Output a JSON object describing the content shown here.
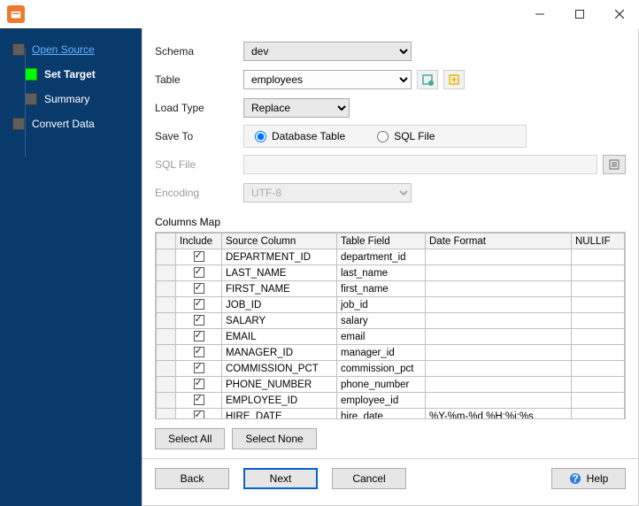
{
  "window": {
    "minimize": "—",
    "maximize": "☐",
    "close": "✕"
  },
  "sidebar": {
    "items": [
      {
        "label": "Open Source"
      },
      {
        "label": "Set Target"
      },
      {
        "label": "Summary"
      },
      {
        "label": "Convert Data"
      }
    ]
  },
  "form": {
    "schema_label": "Schema",
    "schema_value": "dev",
    "table_label": "Table",
    "table_value": "employees",
    "loadtype_label": "Load Type",
    "loadtype_value": "Replace",
    "saveto_label": "Save To",
    "saveto_db": "Database Table",
    "saveto_sql": "SQL File",
    "sqlfile_label": "SQL File",
    "sqlfile_value": "",
    "encoding_label": "Encoding",
    "encoding_value": "UTF-8"
  },
  "columns": {
    "heading": "Columns Map",
    "headers": {
      "include": "Include",
      "source": "Source Column",
      "field": "Table Field",
      "dateformat": "Date Format",
      "nullif": "NULLIF"
    },
    "rows": [
      {
        "include": true,
        "source": "DEPARTMENT_ID",
        "field": "department_id",
        "dateformat": "",
        "nullif": ""
      },
      {
        "include": true,
        "source": "LAST_NAME",
        "field": "last_name",
        "dateformat": "",
        "nullif": ""
      },
      {
        "include": true,
        "source": "FIRST_NAME",
        "field": "first_name",
        "dateformat": "",
        "nullif": ""
      },
      {
        "include": true,
        "source": "JOB_ID",
        "field": "job_id",
        "dateformat": "",
        "nullif": ""
      },
      {
        "include": true,
        "source": "SALARY",
        "field": "salary",
        "dateformat": "",
        "nullif": ""
      },
      {
        "include": true,
        "source": "EMAIL",
        "field": "email",
        "dateformat": "",
        "nullif": ""
      },
      {
        "include": true,
        "source": "MANAGER_ID",
        "field": "manager_id",
        "dateformat": "",
        "nullif": ""
      },
      {
        "include": true,
        "source": "COMMISSION_PCT",
        "field": "commission_pct",
        "dateformat": "",
        "nullif": ""
      },
      {
        "include": true,
        "source": "PHONE_NUMBER",
        "field": "phone_number",
        "dateformat": "",
        "nullif": ""
      },
      {
        "include": true,
        "source": "EMPLOYEE_ID",
        "field": "employee_id",
        "dateformat": "",
        "nullif": ""
      },
      {
        "include": true,
        "source": "HIRE_DATE",
        "field": "hire_date",
        "dateformat": "%Y-%m-%d %H:%i:%s",
        "nullif": ""
      }
    ]
  },
  "buttons": {
    "select_all": "Select All",
    "select_none": "Select None",
    "back": "Back",
    "next": "Next",
    "cancel": "Cancel",
    "help": "Help"
  }
}
